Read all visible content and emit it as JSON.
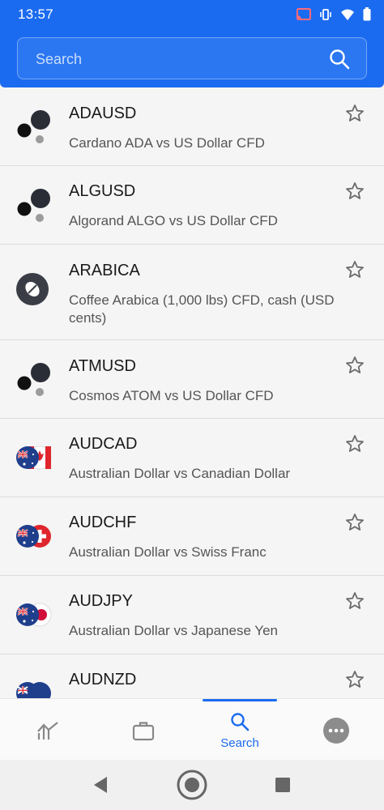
{
  "status_bar": {
    "time": "13:57"
  },
  "search": {
    "placeholder": "Search"
  },
  "instruments": [
    {
      "symbol": "ADAUSD",
      "description": "Cardano ADA vs US Dollar CFD",
      "logo": "crypto-dots-icon"
    },
    {
      "symbol": "ALGUSD",
      "description": "Algorand ALGO vs US Dollar CFD",
      "logo": "crypto-dots-icon"
    },
    {
      "symbol": "ARABICA",
      "description": "Coffee Arabica (1,000 lbs) CFD, cash (USD cents)",
      "logo": "coffee-bean-icon"
    },
    {
      "symbol": "ATMUSD",
      "description": "Cosmos ATOM vs US Dollar CFD",
      "logo": "crypto-dots-icon"
    },
    {
      "symbol": "AUDCAD",
      "description": "Australian Dollar vs Canadian Dollar",
      "logo": "flag-au-ca-icon"
    },
    {
      "symbol": "AUDCHF",
      "description": "Australian Dollar vs Swiss Franc",
      "logo": "flag-au-ch-icon"
    },
    {
      "symbol": "AUDJPY",
      "description": "Australian Dollar vs Japanese Yen",
      "logo": "flag-au-jp-icon"
    },
    {
      "symbol": "AUDNZD",
      "description": "",
      "logo": "flag-au-nz-icon"
    }
  ],
  "bottom_nav": {
    "tabs": [
      {
        "id": "markets",
        "label": "",
        "icon": "chart-icon"
      },
      {
        "id": "portfolio",
        "label": "",
        "icon": "briefcase-icon"
      },
      {
        "id": "search",
        "label": "Search",
        "icon": "search-icon",
        "active": true
      },
      {
        "id": "more",
        "label": "",
        "icon": "more-icon"
      }
    ]
  },
  "colors": {
    "accent": "#1b6bf0",
    "text": "#1a1a1a",
    "muted": "#555555",
    "bg": "#f5f5f5"
  }
}
